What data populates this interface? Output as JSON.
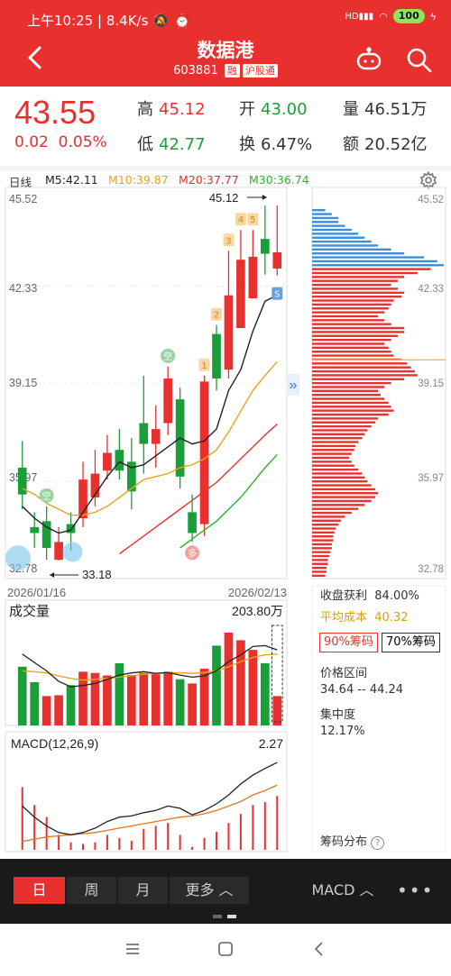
{
  "status_bar": {
    "time": "上午10:25",
    "speed": "8.4K/s",
    "signal": "HD",
    "battery": "100"
  },
  "header": {
    "title": "数据港",
    "code": "603881",
    "tag1": "融",
    "tag2": "沪股通",
    "back_icon": "chevron-left-icon",
    "robot_icon": "robot-icon",
    "search_icon": "search-icon"
  },
  "quote": {
    "price": "43.55",
    "change": "0.02",
    "change_pct": "0.05%",
    "high_label": "高",
    "high": "45.12",
    "open_label": "开",
    "open": "43.00",
    "volume_label": "量",
    "volume": "46.51万",
    "low_label": "低",
    "low": "42.77",
    "turnover_label": "换",
    "turnover": "6.47%",
    "amount_label": "额",
    "amount": "20.52亿"
  },
  "ma_legend": {
    "period": "日线",
    "ma5": "M5:42.11",
    "ma10": "M10:39.87",
    "ma20": "M20:37.77",
    "ma30": "M30:36.74"
  },
  "colors": {
    "up": "#e8312f",
    "down": "#1a9e3a",
    "ma5": "#222222",
    "ma10": "#e8a317",
    "ma20": "#e8312f",
    "ma30": "#2fb32f",
    "chip_profit": "#e8312f",
    "chip_loss": "#3b8fd8"
  },
  "chart_data": [
    {
      "type": "candlestick",
      "y_ticks": [
        "45.52",
        "42.33",
        "39.15",
        "35.97",
        "32.78"
      ],
      "ylim": [
        32.78,
        45.52
      ],
      "x_start": "2026/01/16",
      "x_end": "2026/02/13",
      "max_label": "45.12",
      "min_label": "33.18",
      "candles": [
        {
          "o": 36.3,
          "c": 35.4,
          "h": 37.2,
          "l": 34.9
        },
        {
          "o": 34.3,
          "c": 34.1,
          "h": 34.8,
          "l": 33.6
        },
        {
          "o": 34.5,
          "c": 33.6,
          "h": 35.0,
          "l": 33.2
        },
        {
          "o": 33.2,
          "c": 33.8,
          "h": 34.3,
          "l": 33.18
        },
        {
          "o": 34.4,
          "c": 34.1,
          "h": 34.8,
          "l": 33.5
        },
        {
          "o": 34.6,
          "c": 35.9,
          "h": 36.5,
          "l": 34.3
        },
        {
          "o": 35.3,
          "c": 36.1,
          "h": 36.9,
          "l": 35.0
        },
        {
          "o": 36.2,
          "c": 36.8,
          "h": 37.4,
          "l": 35.9
        },
        {
          "o": 36.9,
          "c": 36.2,
          "h": 37.6,
          "l": 35.9
        },
        {
          "o": 36.5,
          "c": 35.5,
          "h": 37.3,
          "l": 34.9
        },
        {
          "o": 37.8,
          "c": 37.1,
          "h": 39.4,
          "l": 36.1
        },
        {
          "o": 37.1,
          "c": 37.6,
          "h": 38.4,
          "l": 36.3
        },
        {
          "o": 37.8,
          "c": 39.3,
          "h": 39.7,
          "l": 37.4
        },
        {
          "o": 38.6,
          "c": 36.0,
          "h": 39.0,
          "l": 35.6
        },
        {
          "o": 34.8,
          "c": 34.1,
          "h": 35.4,
          "l": 33.8
        },
        {
          "o": 34.4,
          "c": 39.2,
          "h": 39.4,
          "l": 34.0
        },
        {
          "o": 40.8,
          "c": 39.3,
          "h": 41.1,
          "l": 38.9
        },
        {
          "o": 39.6,
          "c": 42.1,
          "h": 43.6,
          "l": 39.3
        },
        {
          "o": 41.0,
          "c": 43.3,
          "h": 44.3,
          "l": 41.0
        },
        {
          "o": 42.0,
          "c": 43.4,
          "h": 44.3,
          "l": 42.0
        },
        {
          "o": 44.0,
          "c": 43.5,
          "h": 45.12,
          "l": 42.8
        },
        {
          "o": 43.0,
          "c": 43.55,
          "h": 45.12,
          "l": 42.77
        }
      ],
      "ma5": [
        35.0,
        34.6,
        34.3,
        34.1,
        34.2,
        34.8,
        35.4,
        36.0,
        36.5,
        36.3,
        36.4,
        36.7,
        37.0,
        37.3,
        37.1,
        37.2,
        37.6,
        38.9,
        39.6,
        40.9,
        41.9,
        42.11
      ],
      "ma10": [
        35.6,
        35.4,
        35.1,
        34.9,
        34.7,
        34.7,
        34.8,
        35.0,
        35.3,
        35.6,
        35.9,
        36.0,
        36.1,
        36.3,
        36.4,
        36.6,
        36.9,
        37.5,
        38.2,
        38.9,
        39.4,
        39.87
      ],
      "ma20": [
        null,
        null,
        null,
        null,
        null,
        null,
        null,
        null,
        33.4,
        33.7,
        34.0,
        34.3,
        34.6,
        34.9,
        35.2,
        35.5,
        35.8,
        36.2,
        36.6,
        37.0,
        37.4,
        37.77
      ],
      "ma30": [
        null,
        null,
        null,
        null,
        null,
        null,
        null,
        null,
        null,
        null,
        null,
        null,
        null,
        33.6,
        33.9,
        34.2,
        34.5,
        34.9,
        35.3,
        35.8,
        36.3,
        36.74
      ],
      "markers": [
        {
          "index": 2,
          "text": "空",
          "kind": "bear"
        },
        {
          "index": 12,
          "text": "空",
          "kind": "bear"
        },
        {
          "index": 14,
          "text": "多",
          "kind": "bull"
        },
        {
          "index": 15,
          "text": "1",
          "kind": "seq"
        },
        {
          "index": 16,
          "text": "2",
          "kind": "seq"
        },
        {
          "index": 17,
          "text": "3",
          "kind": "seq"
        },
        {
          "index": 18,
          "text": "4",
          "kind": "seq"
        },
        {
          "index": 19,
          "text": "5",
          "kind": "seq"
        },
        {
          "index": 21,
          "text": "S",
          "kind": "sell"
        }
      ]
    },
    {
      "type": "bar",
      "title": "成交量",
      "max_label": "203.80万",
      "values": [
        140,
        103,
        70,
        72,
        96,
        128,
        125,
        119,
        148,
        120,
        125,
        122,
        128,
        110,
        100,
        135,
        190,
        221,
        203,
        180,
        148,
        70
      ],
      "directions": [
        "down",
        "down",
        "up",
        "up",
        "down",
        "up",
        "up",
        "up",
        "down",
        "up",
        "up",
        "up",
        "up",
        "down",
        "up",
        "up",
        "down",
        "up",
        "up",
        "up",
        "down",
        "up"
      ],
      "ma_a": [
        170,
        150,
        130,
        105,
        92,
        95,
        100,
        110,
        120,
        125,
        128,
        124,
        126,
        120,
        115,
        118,
        130,
        152,
        168,
        188,
        190,
        180
      ],
      "ma_b": [
        130,
        128,
        125,
        118,
        112,
        108,
        110,
        112,
        115,
        118,
        122,
        124,
        126,
        125,
        124,
        126,
        130,
        140,
        152,
        162,
        168,
        170
      ]
    },
    {
      "type": "macd",
      "title": "MACD(12,26,9)",
      "value_label": "2.27",
      "dif": [
        0.3,
        -0.2,
        -0.6,
        -0.9,
        -1.0,
        -0.9,
        -0.7,
        -0.4,
        -0.2,
        -0.15,
        0.0,
        0.1,
        0.3,
        0.2,
        -0.1,
        0.1,
        0.4,
        0.8,
        1.3,
        1.7,
        2.0,
        2.27
      ],
      "dea": [
        -1.3,
        -1.2,
        -1.1,
        -1.05,
        -1.0,
        -0.95,
        -0.9,
        -0.8,
        -0.7,
        -0.6,
        -0.5,
        -0.4,
        -0.3,
        -0.2,
        -0.15,
        -0.05,
        0.1,
        0.3,
        0.5,
        0.8,
        1.0,
        1.25
      ],
      "hist": [
        2.1,
        1.5,
        1.1,
        0.5,
        0.25,
        0.2,
        0.25,
        0.5,
        0.4,
        0.3,
        0.7,
        0.8,
        0.9,
        0.5,
        0.1,
        0.4,
        0.6,
        0.9,
        1.2,
        1.5,
        1.6,
        1.8
      ]
    },
    {
      "type": "chip_distribution",
      "title": "筹码分布",
      "avg_cost": 40.32,
      "current_price": 43.55,
      "bars": [
        0.1,
        0.15,
        0.2,
        0.2,
        0.25,
        0.3,
        0.35,
        0.4,
        0.45,
        0.5,
        0.6,
        0.7,
        0.85,
        0.95,
        1.0,
        0.9,
        0.8,
        0.7,
        0.65,
        0.6,
        0.65,
        0.7,
        0.68,
        0.62,
        0.6,
        0.58,
        0.55,
        0.5,
        0.55,
        0.6,
        0.7,
        0.7,
        0.65,
        0.6,
        0.55,
        0.58,
        0.6,
        0.62,
        0.68,
        0.72,
        0.75,
        0.78,
        0.8,
        0.7,
        0.6,
        0.55,
        0.5,
        0.52,
        0.55,
        0.58,
        0.6,
        0.62,
        0.58,
        0.5,
        0.48,
        0.45,
        0.42,
        0.4,
        0.38,
        0.35,
        0.33,
        0.32,
        0.3,
        0.28,
        0.3,
        0.32,
        0.35,
        0.38,
        0.4,
        0.42,
        0.45,
        0.48,
        0.5,
        0.48,
        0.45,
        0.4,
        0.35,
        0.3,
        0.25,
        0.22,
        0.2,
        0.18,
        0.17,
        0.16,
        0.16,
        0.15,
        0.15,
        0.14,
        0.13,
        0.12,
        0.12,
        0.11,
        0.11,
        0.1
      ]
    }
  ],
  "chip_panel": {
    "profit_label": "收盘获利",
    "profit_value": "84.00%",
    "avg_label": "平均成本",
    "avg_value": "40.32",
    "btn90": "90%筹码",
    "btn70": "70%筹码",
    "range_label": "价格区间",
    "range_value": "34.64 -- 44.24",
    "conc_label": "集中度",
    "conc_value": "12.17%",
    "chip_title": "筹码分布"
  },
  "bottom_tabs": {
    "day": "日",
    "week": "周",
    "month": "月",
    "more": "更多",
    "indicator": "MACD",
    "menu_icon": "more-dots-icon"
  },
  "nav": {
    "menu_icon": "menu-icon",
    "home_icon": "home-icon",
    "back_icon": "back-icon"
  }
}
